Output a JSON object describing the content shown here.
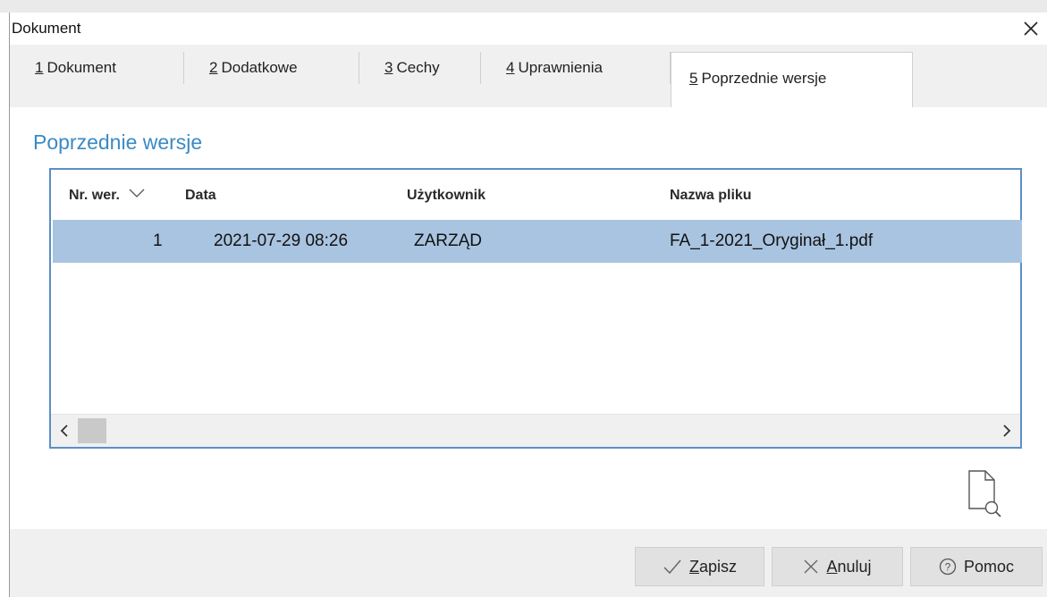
{
  "window": {
    "title": "Dokument"
  },
  "tabs": [
    {
      "num": "1",
      "label": "Dokument"
    },
    {
      "num": "2",
      "label": "Dodatkowe"
    },
    {
      "num": "3",
      "label": "Cechy"
    },
    {
      "num": "4",
      "label": "Uprawnienia"
    },
    {
      "num": "5",
      "label": "Poprzednie wersje"
    }
  ],
  "active_tab": "5",
  "section": {
    "title": "Poprzednie wersje"
  },
  "grid": {
    "columns": [
      "Nr. wer.",
      "Data",
      "Użytkownik",
      "Nazwa pliku"
    ],
    "sort_column": "Nr. wer.",
    "rows": [
      {
        "version": "1",
        "date": "2021-07-29 08:26",
        "user": "ZARZĄD",
        "filename": "FA_1-2021_Oryginał_1.pdf"
      }
    ]
  },
  "buttons": {
    "save": {
      "icon": "check-icon",
      "accel": "Z",
      "rest": "apisz"
    },
    "cancel": {
      "icon": "x-icon",
      "accel": "A",
      "rest": "nuluj"
    },
    "help": {
      "icon": "help-icon",
      "label": "Pomoc"
    }
  },
  "colors": {
    "accent": "#3b8ac4",
    "grid_border": "#5b8fc6",
    "selected_row": "#a9c4e0"
  }
}
